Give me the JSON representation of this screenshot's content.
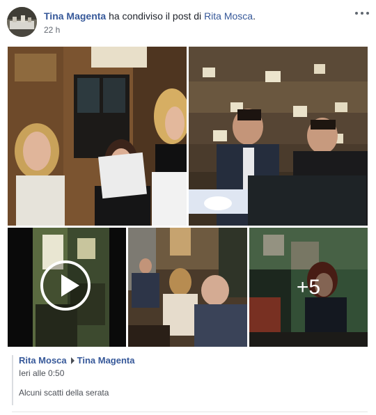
{
  "post": {
    "author": "Tina Magenta",
    "action_text": "ha condiviso il post di",
    "shared_from": "Rita Mosca",
    "shared_suffix": ".",
    "timestamp": "22 h",
    "more_icon": "more-horizontal-icon"
  },
  "media": {
    "photos": [
      {
        "name": "photo-women-reading",
        "type": "photo"
      },
      {
        "name": "photo-men-laptop",
        "type": "photo"
      },
      {
        "name": "video-room",
        "type": "video",
        "icon": "play-icon"
      },
      {
        "name": "photo-audience",
        "type": "photo"
      },
      {
        "name": "photo-green-room",
        "type": "photo"
      }
    ],
    "more_count": "+5"
  },
  "shared_post": {
    "author": "Rita Mosca",
    "target": "Tina Magenta",
    "separator_icon": "triangle-right-icon",
    "time": "Ieri alle 0:50",
    "caption": "Alcuni scatti della serata"
  },
  "colors": {
    "link": "#365899",
    "text": "#1d2129",
    "secondary": "#616770"
  }
}
